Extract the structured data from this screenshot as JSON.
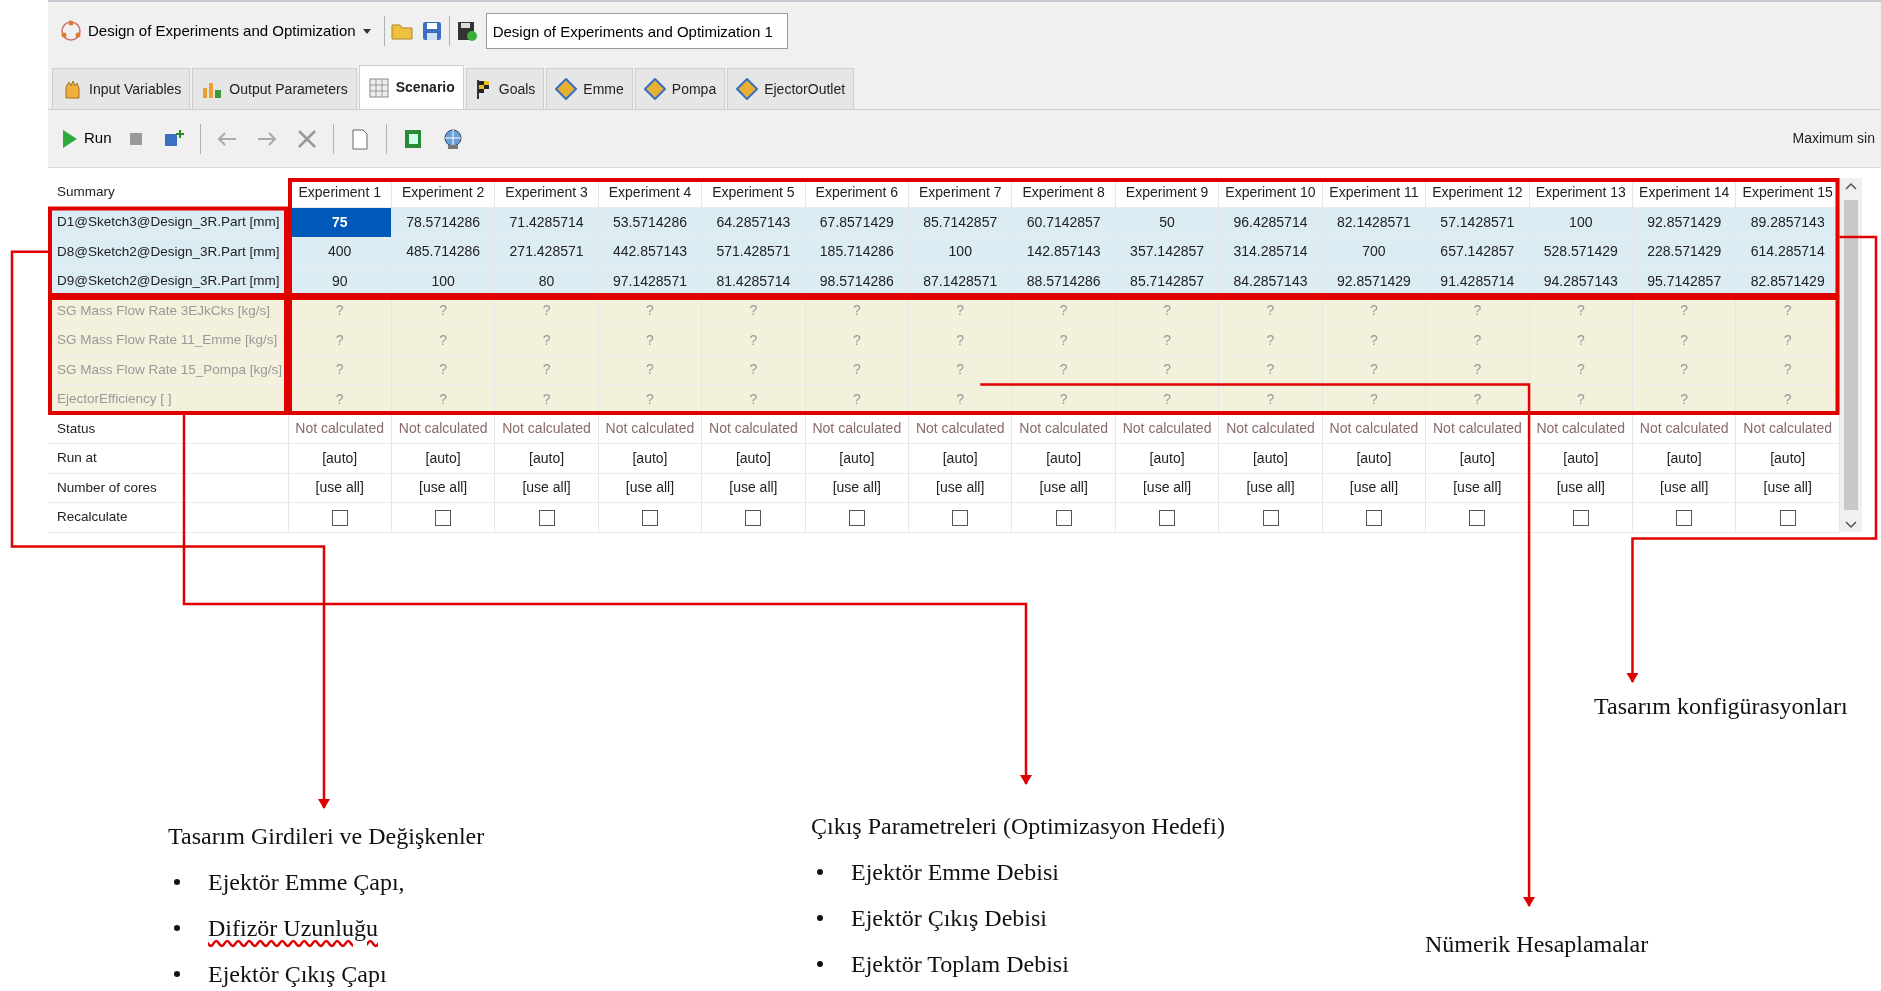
{
  "header": {
    "study_dropdown": "Design of Experiments and Optimization",
    "name_field": "Design of Experiments and Optimization 1"
  },
  "tabs": [
    {
      "label": "Input Variables",
      "selected": false
    },
    {
      "label": "Output Parameters",
      "selected": false
    },
    {
      "label": "Scenario",
      "selected": true
    },
    {
      "label": "Goals",
      "selected": false
    },
    {
      "label": "Emme",
      "selected": false
    },
    {
      "label": "Pompa",
      "selected": false
    },
    {
      "label": "EjectorOutlet",
      "selected": false
    }
  ],
  "toolbar": {
    "run_label": "Run",
    "right_label": "Maximum sin"
  },
  "table": {
    "corner": "Summary",
    "columns": [
      "Experiment 1",
      "Experiment 2",
      "Experiment 3",
      "Experiment 4",
      "Experiment 5",
      "Experiment 6",
      "Experiment 7",
      "Experiment 8",
      "Experiment 9",
      "Experiment 10",
      "Experiment 11",
      "Experiment 12",
      "Experiment 13",
      "Experiment 14",
      "Experiment 15"
    ],
    "rows": [
      {
        "kind": "input",
        "label": "D1@Sketch3@Design_3R.Part [mm]",
        "cells": [
          {
            "value": "75",
            "selected": true
          },
          {
            "value": "78.5714286",
            "selected": false
          },
          {
            "value": "71.4285714",
            "selected": false
          },
          {
            "value": "53.5714286",
            "selected": false
          },
          {
            "value": "64.2857143",
            "selected": false
          },
          {
            "value": "67.8571429",
            "selected": false
          },
          {
            "value": "85.7142857",
            "selected": false
          },
          {
            "value": "60.7142857",
            "selected": false
          },
          {
            "value": "50",
            "selected": false
          },
          {
            "value": "96.4285714",
            "selected": false
          },
          {
            "value": "82.1428571",
            "selected": false
          },
          {
            "value": "57.1428571",
            "selected": false
          },
          {
            "value": "100",
            "selected": false
          },
          {
            "value": "92.8571429",
            "selected": false
          },
          {
            "value": "89.2857143",
            "selected": false
          }
        ]
      },
      {
        "kind": "input",
        "label": "D8@Sketch2@Design_3R.Part [mm]",
        "cells": [
          {
            "value": "400",
            "selected": false
          },
          {
            "value": "485.714286",
            "selected": false
          },
          {
            "value": "271.428571",
            "selected": false
          },
          {
            "value": "442.857143",
            "selected": false
          },
          {
            "value": "571.428571",
            "selected": false
          },
          {
            "value": "185.714286",
            "selected": false
          },
          {
            "value": "100",
            "selected": false
          },
          {
            "value": "142.857143",
            "selected": false
          },
          {
            "value": "357.142857",
            "selected": false
          },
          {
            "value": "314.285714",
            "selected": false
          },
          {
            "value": "700",
            "selected": false
          },
          {
            "value": "657.142857",
            "selected": false
          },
          {
            "value": "528.571429",
            "selected": false
          },
          {
            "value": "228.571429",
            "selected": false
          },
          {
            "value": "614.285714",
            "selected": false
          }
        ]
      },
      {
        "kind": "input",
        "label": "D9@Sketch2@Design_3R.Part [mm]",
        "cells": [
          {
            "value": "90",
            "selected": false
          },
          {
            "value": "100",
            "selected": false
          },
          {
            "value": "80",
            "selected": false
          },
          {
            "value": "97.1428571",
            "selected": false
          },
          {
            "value": "81.4285714",
            "selected": false
          },
          {
            "value": "98.5714286",
            "selected": false
          },
          {
            "value": "87.1428571",
            "selected": false
          },
          {
            "value": "88.5714286",
            "selected": false
          },
          {
            "value": "85.7142857",
            "selected": false
          },
          {
            "value": "84.2857143",
            "selected": false
          },
          {
            "value": "92.8571429",
            "selected": false
          },
          {
            "value": "91.4285714",
            "selected": false
          },
          {
            "value": "94.2857143",
            "selected": false
          },
          {
            "value": "95.7142857",
            "selected": false
          },
          {
            "value": "82.8571429",
            "selected": false
          }
        ]
      },
      {
        "kind": "output",
        "label": "SG Mass Flow Rate 3EJkCks [kg/s]",
        "cells": [
          "?",
          "?",
          "?",
          "?",
          "?",
          "?",
          "?",
          "?",
          "?",
          "?",
          "?",
          "?",
          "?",
          "?",
          "?"
        ]
      },
      {
        "kind": "output",
        "label": "SG Mass Flow Rate 11_Emme [kg/s]",
        "cells": [
          "?",
          "?",
          "?",
          "?",
          "?",
          "?",
          "?",
          "?",
          "?",
          "?",
          "?",
          "?",
          "?",
          "?",
          "?"
        ]
      },
      {
        "kind": "output",
        "label": "SG Mass Flow Rate 15_Pompa [kg/s]",
        "cells": [
          "?",
          "?",
          "?",
          "?",
          "?",
          "?",
          "?",
          "?",
          "?",
          "?",
          "?",
          "?",
          "?",
          "?",
          "?"
        ]
      },
      {
        "kind": "output",
        "label": "EjectorEfficiency [ ]",
        "cells": [
          "?",
          "?",
          "?",
          "?",
          "?",
          "?",
          "?",
          "?",
          "?",
          "?",
          "?",
          "?",
          "?",
          "?",
          "?"
        ]
      },
      {
        "kind": "status",
        "label": "Status",
        "cells": [
          "Not calculated",
          "Not calculated",
          "Not calculated",
          "Not calculated",
          "Not calculated",
          "Not calculated",
          "Not calculated",
          "Not calculated",
          "Not calculated",
          "Not calculated",
          "Not calculated",
          "Not calculated",
          "Not calculated",
          "Not calculated",
          "Not calculated"
        ]
      },
      {
        "kind": "text",
        "label": "Run at",
        "cells": [
          "[auto]",
          "[auto]",
          "[auto]",
          "[auto]",
          "[auto]",
          "[auto]",
          "[auto]",
          "[auto]",
          "[auto]",
          "[auto]",
          "[auto]",
          "[auto]",
          "[auto]",
          "[auto]",
          "[auto]"
        ]
      },
      {
        "kind": "text",
        "label": "Number of cores",
        "cells": [
          "[use all]",
          "[use all]",
          "[use all]",
          "[use all]",
          "[use all]",
          "[use all]",
          "[use all]",
          "[use all]",
          "[use all]",
          "[use all]",
          "[use all]",
          "[use all]",
          "[use all]",
          "[use all]",
          "[use all]"
        ]
      },
      {
        "kind": "checkbox",
        "label": "Recalculate",
        "cells": [
          {
            "checked": false
          },
          {
            "checked": false
          },
          {
            "checked": false
          },
          {
            "checked": false
          },
          {
            "checked": false
          },
          {
            "checked": false
          },
          {
            "checked": false
          },
          {
            "checked": false
          },
          {
            "checked": false
          },
          {
            "checked": false
          },
          {
            "checked": false
          },
          {
            "checked": false
          },
          {
            "checked": false
          },
          {
            "checked": false
          },
          {
            "checked": false
          }
        ]
      }
    ]
  },
  "annotations": [
    {
      "title": "Tasarım Girdileri ve Değişkenler",
      "bullets": [
        {
          "text": "Ejektör Emme Çapı,",
          "spell_flag": false
        },
        {
          "text": "Difizör Uzunluğu",
          "spell_flag": true
        },
        {
          "text": "Ejektör Çıkış Çapı",
          "spell_flag": false
        }
      ]
    },
    {
      "title": "Çıkış Parametreleri (Optimizasyon Hedefi)",
      "bullets": [
        {
          "text": "Ejektör Emme Debisi",
          "spell_flag": false
        },
        {
          "text": "Ejektör Çıkış Debisi",
          "spell_flag": false
        },
        {
          "text": "Ejektör Toplam Debisi",
          "spell_flag": false
        }
      ]
    },
    {
      "title": "Nümerik Hesaplamalar"
    },
    {
      "title": "Tasarım konfigürasyonları"
    }
  ]
}
